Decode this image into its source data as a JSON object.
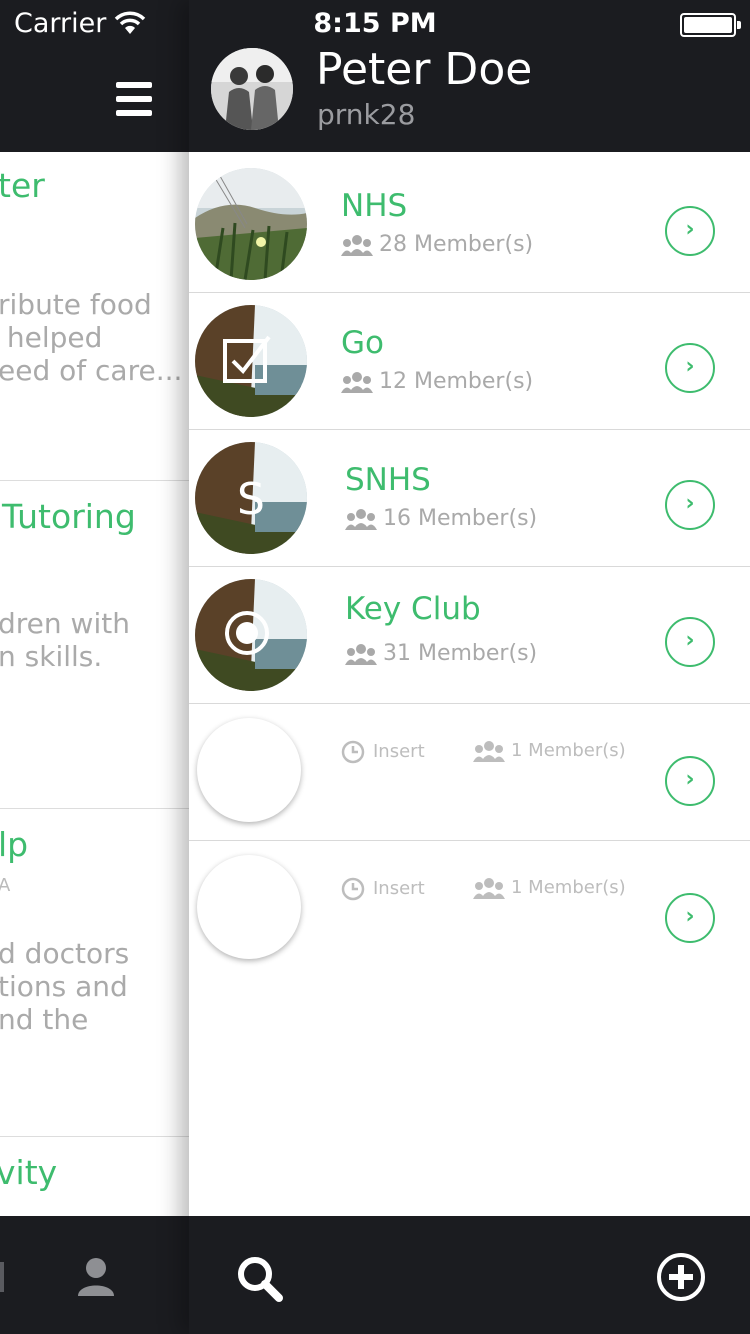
{
  "status_bar": {
    "carrier": "Carrier",
    "time": "8:15 PM"
  },
  "profile": {
    "name": "Peter Doe",
    "handle": "prnk28"
  },
  "left_panel": {
    "cards": [
      {
        "title": "ter",
        "subtitle": "",
        "description": "ribute food\n helped\need of care..."
      },
      {
        "title": "Tutoring",
        "subtitle": "",
        "description": "dren with\nn skills."
      },
      {
        "title": "lp",
        "subtitle": "A",
        "description": "d doctors\ntions and\nnd the"
      },
      {
        "title": "vity",
        "subtitle": "",
        "description": ""
      }
    ]
  },
  "groups": [
    {
      "name": "NHS",
      "members": "28 Member(s)",
      "image": "grass-photo"
    },
    {
      "name": "Go",
      "members": "12 Member(s)",
      "image": "waterfall-photo",
      "overlay": "checkbox-icon"
    },
    {
      "name": "SNHS",
      "members": "16 Member(s)",
      "image": "waterfall-photo",
      "overlay": "S"
    },
    {
      "name": "Key Club",
      "members": "31 Member(s)",
      "image": "waterfall-photo",
      "overlay": "record-icon"
    }
  ],
  "pending": [
    {
      "label": "Insert",
      "members": "1 Member(s)"
    },
    {
      "label": "Insert",
      "members": "1 Member(s)"
    }
  ],
  "colors": {
    "accent": "#3ebc6e",
    "dark": "#1b1c20"
  }
}
